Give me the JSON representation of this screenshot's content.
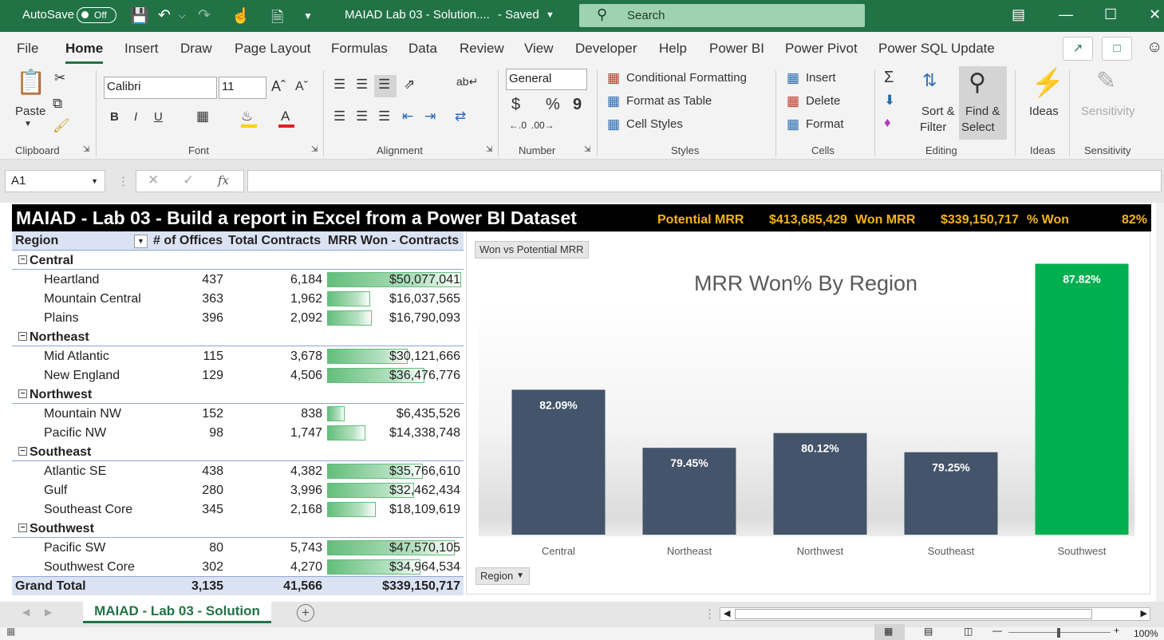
{
  "titlebar": {
    "autosave_label": "AutoSave",
    "autosave_state": "Off",
    "doc_title": "MAIAD Lab 03 - Solution....",
    "saved_state": "- Saved",
    "search_placeholder": "Search"
  },
  "menu": [
    "File",
    "Home",
    "Insert",
    "Draw",
    "Page Layout",
    "Formulas",
    "Data",
    "Review",
    "View",
    "Developer",
    "Help",
    "Power BI",
    "Power Pivot",
    "Power SQL Update"
  ],
  "ribbon": {
    "clipboard": {
      "paste": "Paste",
      "group": "Clipboard"
    },
    "font": {
      "name": "Calibri",
      "size": "11",
      "group": "Font",
      "bold": "B",
      "italic": "I",
      "underline": "U"
    },
    "alignment": {
      "group": "Alignment"
    },
    "number": {
      "format": "General",
      "currency": "$",
      "percent": "%",
      "comma": "9",
      "group": "Number"
    },
    "styles": {
      "conditional": "Conditional Formatting",
      "format_table": "Format as Table",
      "cell_styles": "Cell Styles",
      "group": "Styles"
    },
    "cells": {
      "insert": "Insert",
      "delete": "Delete",
      "format": "Format",
      "group": "Cells"
    },
    "editing": {
      "sort_l1": "Sort &",
      "sort_l2": "Filter",
      "find_l1": "Find &",
      "find_l2": "Select",
      "group": "Editing"
    },
    "ideas": {
      "label": "Ideas",
      "group": "Ideas"
    },
    "sensitivity": {
      "label": "Sensitivity",
      "group": "Sensitivity"
    }
  },
  "formula_bar": {
    "name_box": "A1",
    "fx": "fx",
    "content": ""
  },
  "banner": {
    "title": "MAIAD - Lab 03 - Build a report in Excel from a Power BI Dataset",
    "potential_label": "Potential MRR",
    "potential_value": "$413,685,429",
    "won_label": "Won MRR",
    "won_value": "$339,150,717",
    "pct_label": "% Won",
    "pct_value": "82%"
  },
  "pivot": {
    "headers": [
      "Region",
      "# of Offices",
      "Total Contracts",
      "MRR Won - Contracts"
    ],
    "groups": [
      {
        "name": "Central",
        "rows": [
          {
            "name": "Heartland",
            "offices": "437",
            "contracts": "6,184",
            "mrr": "$50,077,041",
            "mrr_value": 50077041
          },
          {
            "name": "Mountain Central",
            "offices": "363",
            "contracts": "1,962",
            "mrr": "$16,037,565",
            "mrr_value": 16037565
          },
          {
            "name": "Plains",
            "offices": "396",
            "contracts": "2,092",
            "mrr": "$16,790,093",
            "mrr_value": 16790093
          }
        ]
      },
      {
        "name": "Northeast",
        "rows": [
          {
            "name": "Mid Atlantic",
            "offices": "115",
            "contracts": "3,678",
            "mrr": "$30,121,666",
            "mrr_value": 30121666
          },
          {
            "name": "New England",
            "offices": "129",
            "contracts": "4,506",
            "mrr": "$36,476,776",
            "mrr_value": 36476776
          }
        ]
      },
      {
        "name": "Northwest",
        "rows": [
          {
            "name": "Mountain NW",
            "offices": "152",
            "contracts": "838",
            "mrr": "$6,435,526",
            "mrr_value": 6435526
          },
          {
            "name": "Pacific NW",
            "offices": "98",
            "contracts": "1,747",
            "mrr": "$14,338,748",
            "mrr_value": 14338748
          }
        ]
      },
      {
        "name": "Southeast",
        "rows": [
          {
            "name": "Atlantic SE",
            "offices": "438",
            "contracts": "4,382",
            "mrr": "$35,766,610",
            "mrr_value": 35766610
          },
          {
            "name": "Gulf",
            "offices": "280",
            "contracts": "3,996",
            "mrr": "$32,462,434",
            "mrr_value": 32462434
          },
          {
            "name": "Southeast Core",
            "offices": "345",
            "contracts": "2,168",
            "mrr": "$18,109,619",
            "mrr_value": 18109619
          }
        ]
      },
      {
        "name": "Southwest",
        "rows": [
          {
            "name": "Pacific SW",
            "offices": "80",
            "contracts": "5,743",
            "mrr": "$47,570,105",
            "mrr_value": 47570105
          },
          {
            "name": "Southwest Core",
            "offices": "302",
            "contracts": "4,270",
            "mrr": "$34,964,534",
            "mrr_value": 34964534
          }
        ]
      }
    ],
    "grand_total": {
      "label": "Grand Total",
      "offices": "3,135",
      "contracts": "41,566",
      "mrr": "$339,150,717"
    }
  },
  "chart_data": {
    "type": "bar",
    "title": "MRR Won% By Region",
    "categories": [
      "Central",
      "Northeast",
      "Northwest",
      "Southeast",
      "Southwest"
    ],
    "values": [
      82.09,
      79.45,
      80.12,
      79.25,
      87.82
    ],
    "labels": [
      "82.09%",
      "79.45%",
      "80.12%",
      "79.25%",
      "87.82%"
    ],
    "ylim": [
      75.5,
      89.0
    ],
    "colors": [
      "#44546a",
      "#44546a",
      "#44546a",
      "#44546a",
      "#00b050"
    ],
    "field_button": "Won vs Potential MRR",
    "axis_button": "Region"
  },
  "sheet_tab": "MAIAD - Lab 03 - Solution",
  "zoom": "100%"
}
